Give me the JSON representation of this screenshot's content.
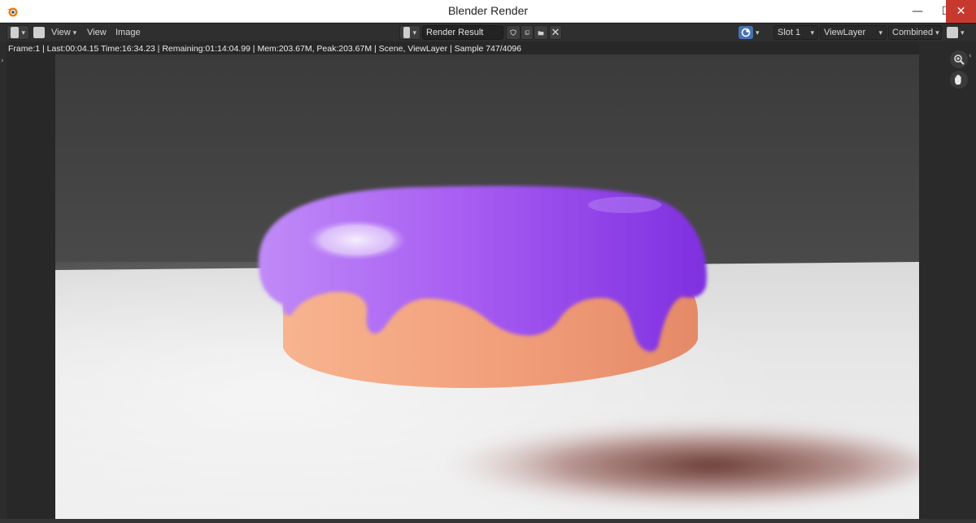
{
  "window": {
    "title": "Blender Render",
    "minimize_glyph": "—",
    "maximize_glyph": "☐",
    "close_glyph": "✕"
  },
  "header": {
    "menus": {
      "view_dropdown": "View",
      "view": "View",
      "image": "Image"
    },
    "image_name": "Render Result",
    "slot": "Slot 1",
    "view_layer": "ViewLayer",
    "render_pass": "Combined"
  },
  "stats": "Frame:1 | Last:00:04.15 Time:16:34.23 | Remaining:01:14:04.99 | Mem:203.67M, Peak:203.67M | Scene, ViewLayer | Sample 747/4096",
  "icons": {
    "app": "blender-logo-icon",
    "editor": "image-editor-icon",
    "image": "image-icon",
    "shield": "fake-user-icon",
    "new": "new-image-icon",
    "open": "folder-icon",
    "unlink": "close-icon",
    "zoom": "zoom-icon",
    "pan": "hand-icon"
  },
  "colors": {
    "accent": "#4772b3",
    "close_button": "#c7392f",
    "icing": "#a35cf0",
    "cake": "#f1a07d"
  }
}
